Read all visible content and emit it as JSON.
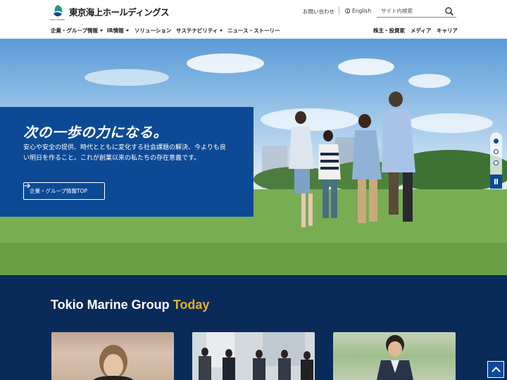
{
  "header": {
    "logo_text": "東京海上ホールディングス",
    "logo_sub": "TOKIO MARINE",
    "contact_label": "お問い合わせ",
    "lang_label": "English",
    "search_placeholder": "サイト内検索"
  },
  "nav": {
    "left": [
      {
        "label": "企業・グループ情報",
        "dropdown": true
      },
      {
        "label": "IR情報",
        "dropdown": true
      },
      {
        "label": "ソリューション",
        "dropdown": false
      },
      {
        "label": "サステナビリティ",
        "dropdown": true
      },
      {
        "label": "ニュース・ストーリー",
        "dropdown": false
      }
    ],
    "right": [
      {
        "label": "株主・投資家"
      },
      {
        "label": "メディア"
      },
      {
        "label": "キャリア"
      }
    ]
  },
  "hero": {
    "title": "次の一歩の力になる。",
    "text": "安心や安全の提供、時代とともに変化する社会課題の解決、今よりも良い明日を作ること。これが創業以来の私たちの存在意義です。",
    "button_label": "企業・グループ情報TOP",
    "slides_count": 3,
    "active_slide": 1
  },
  "today": {
    "title_main": "Tokio Marine Group",
    "title_accent": "Today"
  },
  "colors": {
    "brand_blue": "#0d4a95",
    "section_navy": "#0a2a5a",
    "accent_gold": "#e3b22a"
  }
}
